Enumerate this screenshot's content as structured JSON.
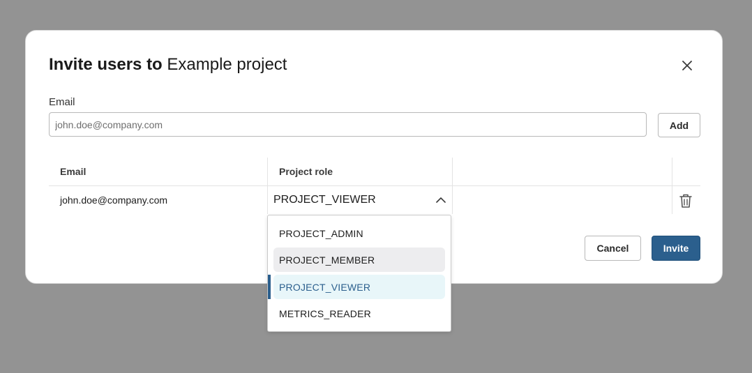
{
  "dialog": {
    "title_bold": "Invite users to",
    "title_project": "Example project"
  },
  "email_field": {
    "label": "Email",
    "value": "",
    "placeholder": "john.doe@company.com"
  },
  "buttons": {
    "add": "Add",
    "cancel": "Cancel",
    "invite": "Invite"
  },
  "table": {
    "headers": {
      "email": "Email",
      "role": "Project role"
    },
    "rows": [
      {
        "email": "john.doe@company.com",
        "role": "PROJECT_VIEWER"
      }
    ]
  },
  "role_dropdown": {
    "options": [
      "PROJECT_ADMIN",
      "PROJECT_MEMBER",
      "PROJECT_VIEWER",
      "METRICS_READER"
    ],
    "hovered": "PROJECT_MEMBER",
    "selected": "PROJECT_VIEWER"
  },
  "icons": {
    "close": "close-icon",
    "chevron": "chevron-up-icon",
    "delete": "trash-icon"
  },
  "colors": {
    "primary": "#2b5f8d",
    "backdrop": "#939393",
    "selected_bg": "#e8f6f9",
    "hover_bg": "#ededef"
  }
}
